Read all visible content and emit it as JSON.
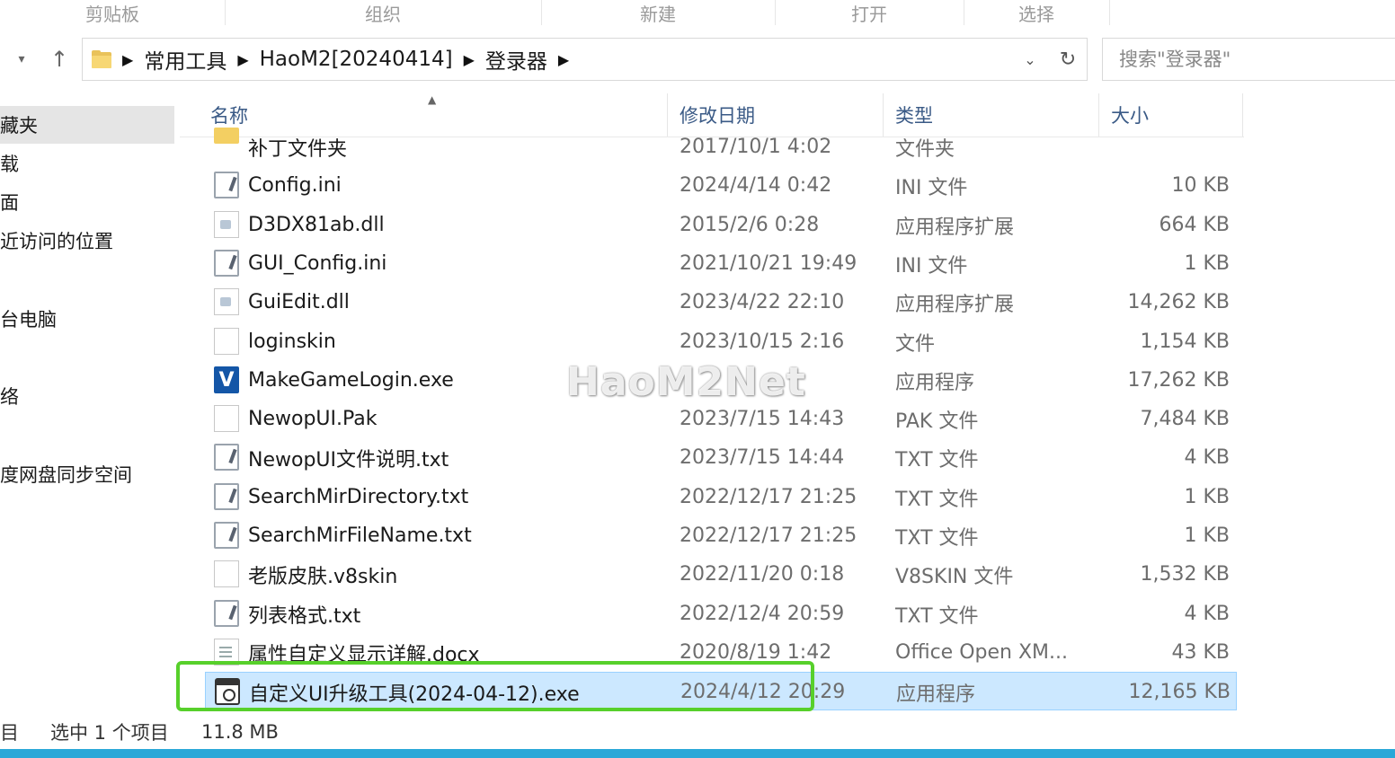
{
  "ribbon": {
    "groups": [
      "剪贴板",
      "组织",
      "新建",
      "打开",
      "选择"
    ]
  },
  "address_bar": {
    "breadcrumb": [
      "常用工具",
      "HaoM2[20240414]",
      "登录器"
    ],
    "search_placeholder": "搜索\"登录器\""
  },
  "nav_pane": {
    "items": [
      "藏夹",
      "载",
      "面",
      "近访问的位置",
      "台电脑",
      "络",
      "度网盘同步空间"
    ]
  },
  "columns": {
    "name": "名称",
    "date": "修改日期",
    "type": "类型",
    "size": "大小"
  },
  "files": [
    {
      "name": "补丁文件夹",
      "date": "2017/10/1 4:02",
      "type": "文件夹",
      "size": "",
      "icon": "folder-icon"
    },
    {
      "name": "Config.ini",
      "date": "2024/4/14 0:42",
      "type": "INI 文件",
      "size": "10 KB",
      "icon": "ini-file-icon"
    },
    {
      "name": "D3DX81ab.dll",
      "date": "2015/2/6 0:28",
      "type": "应用程序扩展",
      "size": "664 KB",
      "icon": "dll-file-icon"
    },
    {
      "name": "GUI_Config.ini",
      "date": "2021/10/21 19:49",
      "type": "INI 文件",
      "size": "1 KB",
      "icon": "ini-file-icon"
    },
    {
      "name": "GuiEdit.dll",
      "date": "2023/4/22 22:10",
      "type": "应用程序扩展",
      "size": "14,262 KB",
      "icon": "dll-file-icon"
    },
    {
      "name": "loginskin",
      "date": "2023/10/15 2:16",
      "type": "文件",
      "size": "1,154 KB",
      "icon": "blank-file-icon"
    },
    {
      "name": "MakeGameLogin.exe",
      "date": "",
      "type": "应用程序",
      "size": "17,262 KB",
      "icon": "vs-app-icon"
    },
    {
      "name": "NewopUI.Pak",
      "date": "2023/7/15 14:43",
      "type": "PAK 文件",
      "size": "7,484 KB",
      "icon": "blank-file-icon"
    },
    {
      "name": "NewopUI文件说明.txt",
      "date": "2023/7/15 14:44",
      "type": "TXT 文件",
      "size": "4 KB",
      "icon": "txt-file-icon"
    },
    {
      "name": "SearchMirDirectory.txt",
      "date": "2022/12/17 21:25",
      "type": "TXT 文件",
      "size": "1 KB",
      "icon": "txt-file-icon"
    },
    {
      "name": "SearchMirFileName.txt",
      "date": "2022/12/17 21:25",
      "type": "TXT 文件",
      "size": "1 KB",
      "icon": "txt-file-icon"
    },
    {
      "name": "老版皮肤.v8skin",
      "date": "2022/11/20 0:18",
      "type": "V8SKIN 文件",
      "size": "1,532 KB",
      "icon": "blank-file-icon"
    },
    {
      "name": "列表格式.txt",
      "date": "2022/12/4 20:59",
      "type": "TXT 文件",
      "size": "4 KB",
      "icon": "txt-file-icon"
    },
    {
      "name": "属性自定义显示详解.docx",
      "date": "2020/8/19 1:42",
      "type": "Office Open XM...",
      "size": "43 KB",
      "icon": "docx-file-icon"
    },
    {
      "name": "自定义UI升级工具(2024-04-12).exe",
      "date": "2024/4/12 20:29",
      "type": "应用程序",
      "size": "12,165 KB",
      "icon": "app-window-icon"
    }
  ],
  "watermark": "HaoM2Net",
  "status": {
    "count_fragment": "目",
    "selected": "选中 1 个项目",
    "size": "11.8 MB"
  },
  "colors": {
    "selection_bg": "#cce8ff",
    "selection_border": "#99d1ff",
    "highlight_box": "#57d02b",
    "taskbar": "#2aa8d8"
  }
}
